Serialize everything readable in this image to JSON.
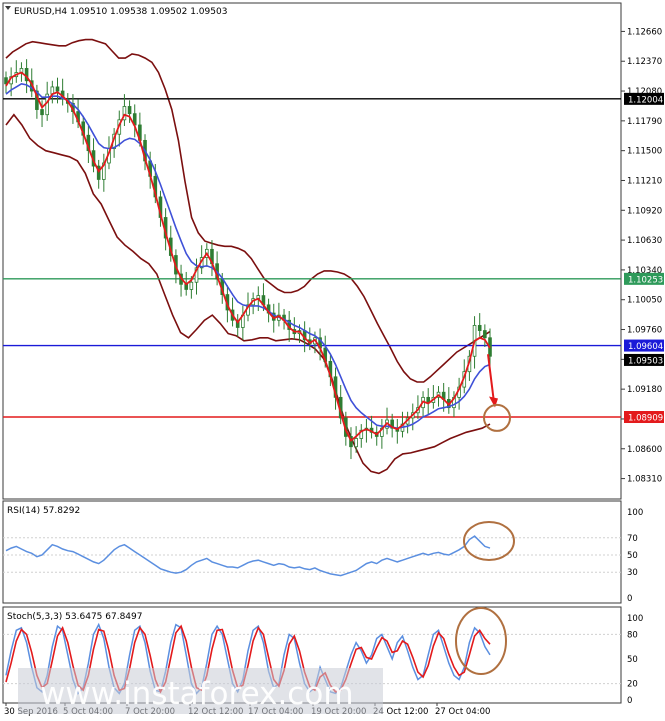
{
  "colors": {
    "background": "#ffffff",
    "frame": "#3a3a3a",
    "grid": "#d0d0d0",
    "candle": "#2e7d32",
    "bands": "#7b0f0f",
    "ma_fast": "#e31a1c",
    "ma_slow": "#3f51d8",
    "rsi_line": "#5b8fe0",
    "stoch_main": "#5b8fe0",
    "stoch_signal": "#e31a1c",
    "circle": "#b07040",
    "arrow": "#e31a1c",
    "line_black": "#000000",
    "line_green": "#2e9a5a",
    "line_blue": "#1a1ad8",
    "line_red": "#e31a1c",
    "watermark": "#9aa0b0"
  },
  "chart_data": [
    {
      "type": "candlestick",
      "title": "EURUSD,H4  1.09510 1.09538 1.09502 1.09503",
      "ylim": [
        1.0816,
        1.1281
      ],
      "y_ticks": [
        "1.12660",
        "1.12370",
        "1.12080",
        "1.11790",
        "1.11500",
        "1.11210",
        "1.10920",
        "1.10630",
        "1.10340",
        "1.10050",
        "1.09760",
        "1.09470",
        "1.09180",
        "1.08890",
        "1.08600",
        "1.08310"
      ],
      "horizontal_lines": [
        {
          "name": "resistance-1.12004",
          "value": 1.12004,
          "label": "1.12004",
          "color": "#000000"
        },
        {
          "name": "resistance-1.10253",
          "value": 1.10253,
          "label": "1.10253",
          "color": "#2e9a5a"
        },
        {
          "name": "level-1.09604",
          "value": 1.09604,
          "label": "1.09604",
          "color": "#1a1ad8"
        },
        {
          "name": "support-1.08909",
          "value": 1.08909,
          "label": "1.08909",
          "color": "#e31a1c"
        }
      ],
      "current_price": {
        "value": 1.09503,
        "label": "1.09503"
      },
      "closes": [
        1.1215,
        1.1222,
        1.1226,
        1.123,
        1.1218,
        1.1208,
        1.119,
        1.1185,
        1.1205,
        1.1212,
        1.1208,
        1.12,
        1.1196,
        1.1188,
        1.1178,
        1.1165,
        1.115,
        1.1135,
        1.1122,
        1.1138,
        1.1152,
        1.1166,
        1.118,
        1.1193,
        1.1186,
        1.1175,
        1.116,
        1.114,
        1.1125,
        1.1105,
        1.1085,
        1.1065,
        1.1048,
        1.103,
        1.102,
        1.1015,
        1.1022,
        1.1036,
        1.1046,
        1.1054,
        1.104,
        1.1025,
        1.101,
        1.0995,
        1.0985,
        1.0978,
        1.099,
        1.1,
        1.1006,
        1.1009,
        1.1,
        1.0992,
        1.0985,
        1.099,
        1.0985,
        1.0976,
        1.0972,
        1.0975,
        1.0966,
        1.0962,
        1.0968,
        1.0958,
        1.0945,
        1.093,
        1.091,
        1.089,
        1.0872,
        1.0862,
        1.087,
        1.0878,
        1.088,
        1.0876,
        1.0872,
        1.088,
        1.0888,
        1.088,
        1.0877,
        1.0884,
        1.089,
        1.0895,
        1.09,
        1.091,
        1.0905,
        1.091,
        1.0915,
        1.0908,
        1.09,
        1.091,
        1.092,
        1.0935,
        1.095,
        1.098,
        1.0975,
        1.0968,
        1.095
      ],
      "bb_upper": [
        1.124,
        1.1246,
        1.125,
        1.1254,
        1.1256,
        1.1255,
        1.1254,
        1.1253,
        1.1252,
        1.1252,
        1.1255,
        1.1257,
        1.1258,
        1.1258,
        1.1256,
        1.1254,
        1.1247,
        1.124,
        1.124,
        1.1244,
        1.1243,
        1.124,
        1.1236,
        1.1226,
        1.121,
        1.119,
        1.116,
        1.112,
        1.1085,
        1.107,
        1.1062,
        1.106,
        1.1058,
        1.1057,
        1.1057,
        1.1055,
        1.1052,
        1.1045,
        1.1035,
        1.1025,
        1.102,
        1.1015,
        1.1012,
        1.1012,
        1.1014,
        1.1018,
        1.1025,
        1.103,
        1.1033,
        1.1033,
        1.1032,
        1.103,
        1.1026,
        1.1018,
        1.1008,
        1.0995,
        1.0982,
        1.097,
        1.0958,
        1.0945,
        1.0935,
        1.0928,
        1.0925,
        1.0925,
        1.093,
        1.0936,
        1.0942,
        1.0948,
        1.0954,
        1.0958,
        1.0962,
        1.0966,
        1.097,
        1.0974
      ],
      "bb_lower": [
        1.1175,
        1.1185,
        1.1175,
        1.1162,
        1.1155,
        1.115,
        1.1148,
        1.1146,
        1.1144,
        1.114,
        1.1128,
        1.1108,
        1.1098,
        1.1082,
        1.1066,
        1.1058,
        1.1052,
        1.1045,
        1.104,
        1.103,
        1.101,
        1.099,
        1.0973,
        1.0968,
        1.0976,
        1.0985,
        1.099,
        1.0982,
        1.0972,
        1.097,
        1.0965,
        1.0966,
        1.0968,
        1.0968,
        1.0965,
        1.0966,
        1.0967,
        1.0966,
        1.0962,
        1.0957,
        1.0948,
        1.093,
        1.0905,
        1.088,
        1.0862,
        1.0846,
        1.0838,
        1.0836,
        1.084,
        1.085,
        1.0855,
        1.0856,
        1.0858,
        1.086,
        1.0862,
        1.0866,
        1.087,
        1.0873,
        1.0876,
        1.0878,
        1.088,
        1.0884
      ],
      "ma_fast": [
        1.1213,
        1.1221,
        1.1224,
        1.1226,
        1.1222,
        1.1215,
        1.1203,
        1.1192,
        1.1197,
        1.1205,
        1.1207,
        1.1203,
        1.1198,
        1.119,
        1.1179,
        1.1167,
        1.1153,
        1.114,
        1.113,
        1.1136,
        1.1148,
        1.1162,
        1.1175,
        1.1185,
        1.1183,
        1.1174,
        1.116,
        1.1142,
        1.1126,
        1.1108,
        1.1088,
        1.107,
        1.1053,
        1.1037,
        1.1026,
        1.102,
        1.1024,
        1.1034,
        1.1043,
        1.105,
        1.1041,
        1.1028,
        1.1014,
        1.1,
        1.099,
        1.0983,
        1.099,
        1.0998,
        1.1004,
        1.1006,
        1.1,
        1.0993,
        1.0987,
        1.0989,
        1.0985,
        1.0978,
        1.0974,
        1.0974,
        1.0968,
        1.0963,
        1.0966,
        1.0958,
        1.0946,
        1.0931,
        1.0913,
        1.0895,
        1.0878,
        1.0868,
        1.0872,
        1.0877,
        1.0879,
        1.0877,
        1.0874,
        1.0879,
        1.0885,
        1.0881,
        1.0879,
        1.0883,
        1.0888,
        1.0893,
        1.0898,
        1.0906,
        1.0904,
        1.0908,
        1.0912,
        1.0908,
        1.0903,
        1.0909,
        1.0918,
        1.093,
        1.0945,
        1.0965,
        1.0968,
        1.0966,
        1.0958
      ],
      "ma_slow": [
        1.1205,
        1.1209,
        1.1212,
        1.1215,
        1.1214,
        1.1211,
        1.1207,
        1.1202,
        1.1202,
        1.1203,
        1.1203,
        1.1201,
        1.1199,
        1.1195,
        1.119,
        1.1183,
        1.1175,
        1.1166,
        1.1157,
        1.1153,
        1.1152,
        1.1153,
        1.1156,
        1.116,
        1.1162,
        1.1161,
        1.1157,
        1.115,
        1.1141,
        1.113,
        1.1117,
        1.1103,
        1.1089,
        1.1075,
        1.1062,
        1.105,
        1.1042,
        1.1038,
        1.1037,
        1.1038,
        1.1036,
        1.1032,
        1.1026,
        1.1018,
        1.101,
        1.1003,
        1.1,
        1.0999,
        1.0999,
        1.0999,
        1.0997,
        1.0994,
        1.099,
        1.0988,
        1.0986,
        1.0983,
        1.098,
        1.0978,
        1.0975,
        1.0972,
        1.097,
        1.0966,
        1.096,
        1.0952,
        1.0942,
        1.093,
        1.0918,
        1.0907,
        1.09,
        1.0895,
        1.0891,
        1.0887,
        1.0883,
        1.0882,
        1.0882,
        1.0881,
        1.088,
        1.0881,
        1.0882,
        1.0884,
        1.0887,
        1.0891,
        1.0893,
        1.0896,
        1.0899,
        1.09,
        1.0901,
        1.0903,
        1.0906,
        1.0911,
        1.0918,
        1.0928,
        1.0935,
        1.094,
        1.0942
      ]
    },
    {
      "type": "line",
      "title": "RSI(14) 57.8292",
      "ylim": [
        0,
        100
      ],
      "y_ticks": [
        "100",
        "70",
        "50",
        "30",
        "0"
      ],
      "levels": [
        70,
        50,
        30
      ],
      "values": [
        55,
        58,
        60,
        57,
        54,
        52,
        48,
        50,
        56,
        62,
        60,
        57,
        55,
        54,
        51,
        48,
        45,
        42,
        40,
        44,
        50,
        56,
        60,
        62,
        58,
        54,
        50,
        46,
        42,
        38,
        34,
        32,
        30,
        29,
        30,
        33,
        38,
        42,
        44,
        46,
        42,
        40,
        38,
        36,
        36,
        35,
        38,
        41,
        43,
        44,
        42,
        40,
        38,
        40,
        39,
        36,
        35,
        36,
        34,
        33,
        35,
        32,
        30,
        28,
        27,
        26,
        28,
        30,
        32,
        36,
        40,
        42,
        40,
        44,
        46,
        44,
        42,
        44,
        46,
        48,
        50,
        52,
        50,
        52,
        53,
        51,
        50,
        53,
        56,
        60,
        68,
        72,
        66,
        60,
        58
      ]
    },
    {
      "type": "line",
      "title": "Stoch(5,3,3) 53.6475 67.8497",
      "ylim": [
        0,
        100
      ],
      "y_ticks": [
        "100",
        "80",
        "50",
        "20",
        "0"
      ],
      "levels": [
        80,
        20
      ],
      "x_ticks": [
        "30 Sep 2016",
        "5 Oct 04:00",
        "7 Oct 20:00",
        "12 Oct 12:00",
        "17 Oct 04:00",
        "19 Oct 20:00",
        "24 Oct 12:00",
        "27 Oct 04:00"
      ],
      "series": [
        {
          "values": [
            30,
            60,
            85,
            88,
            70,
            40,
            15,
            10,
            30,
            65,
            90,
            85,
            55,
            25,
            8,
            15,
            45,
            80,
            92,
            75,
            40,
            15,
            8,
            20,
            55,
            85,
            90,
            70,
            35,
            12,
            10,
            35,
            70,
            92,
            88,
            55,
            20,
            8,
            15,
            45,
            80,
            90,
            80,
            50,
            20,
            10,
            25,
            60,
            85,
            90,
            70,
            35,
            15,
            20,
            55,
            80,
            75,
            45,
            20,
            10,
            15,
            40,
            25,
            10,
            8,
            15,
            35,
            55,
            70,
            60,
            45,
            55,
            75,
            80,
            65,
            50,
            70,
            78,
            60,
            40,
            25,
            30,
            55,
            80,
            85,
            65,
            45,
            30,
            25,
            40,
            70,
            88,
            82,
            65,
            55
          ]
        },
        {
          "values": [
            22,
            45,
            72,
            86,
            80,
            58,
            30,
            15,
            20,
            48,
            78,
            88,
            70,
            42,
            18,
            12,
            30,
            62,
            86,
            84,
            60,
            30,
            12,
            14,
            38,
            70,
            88,
            80,
            54,
            25,
            10,
            22,
            52,
            82,
            90,
            72,
            40,
            15,
            12,
            30,
            62,
            85,
            86,
            66,
            36,
            15,
            18,
            42,
            72,
            88,
            80,
            52,
            25,
            17,
            36,
            68,
            78,
            60,
            34,
            16,
            12,
            28,
            33,
            18,
            10,
            12,
            25,
            44,
            62,
            64,
            52,
            50,
            64,
            76,
            72,
            58,
            60,
            72,
            68,
            52,
            34,
            28,
            42,
            66,
            82,
            75,
            56,
            40,
            30,
            34,
            55,
            78,
            85,
            75,
            68
          ]
        }
      ]
    }
  ],
  "watermark": {
    "text": "www.instaforex.com"
  }
}
